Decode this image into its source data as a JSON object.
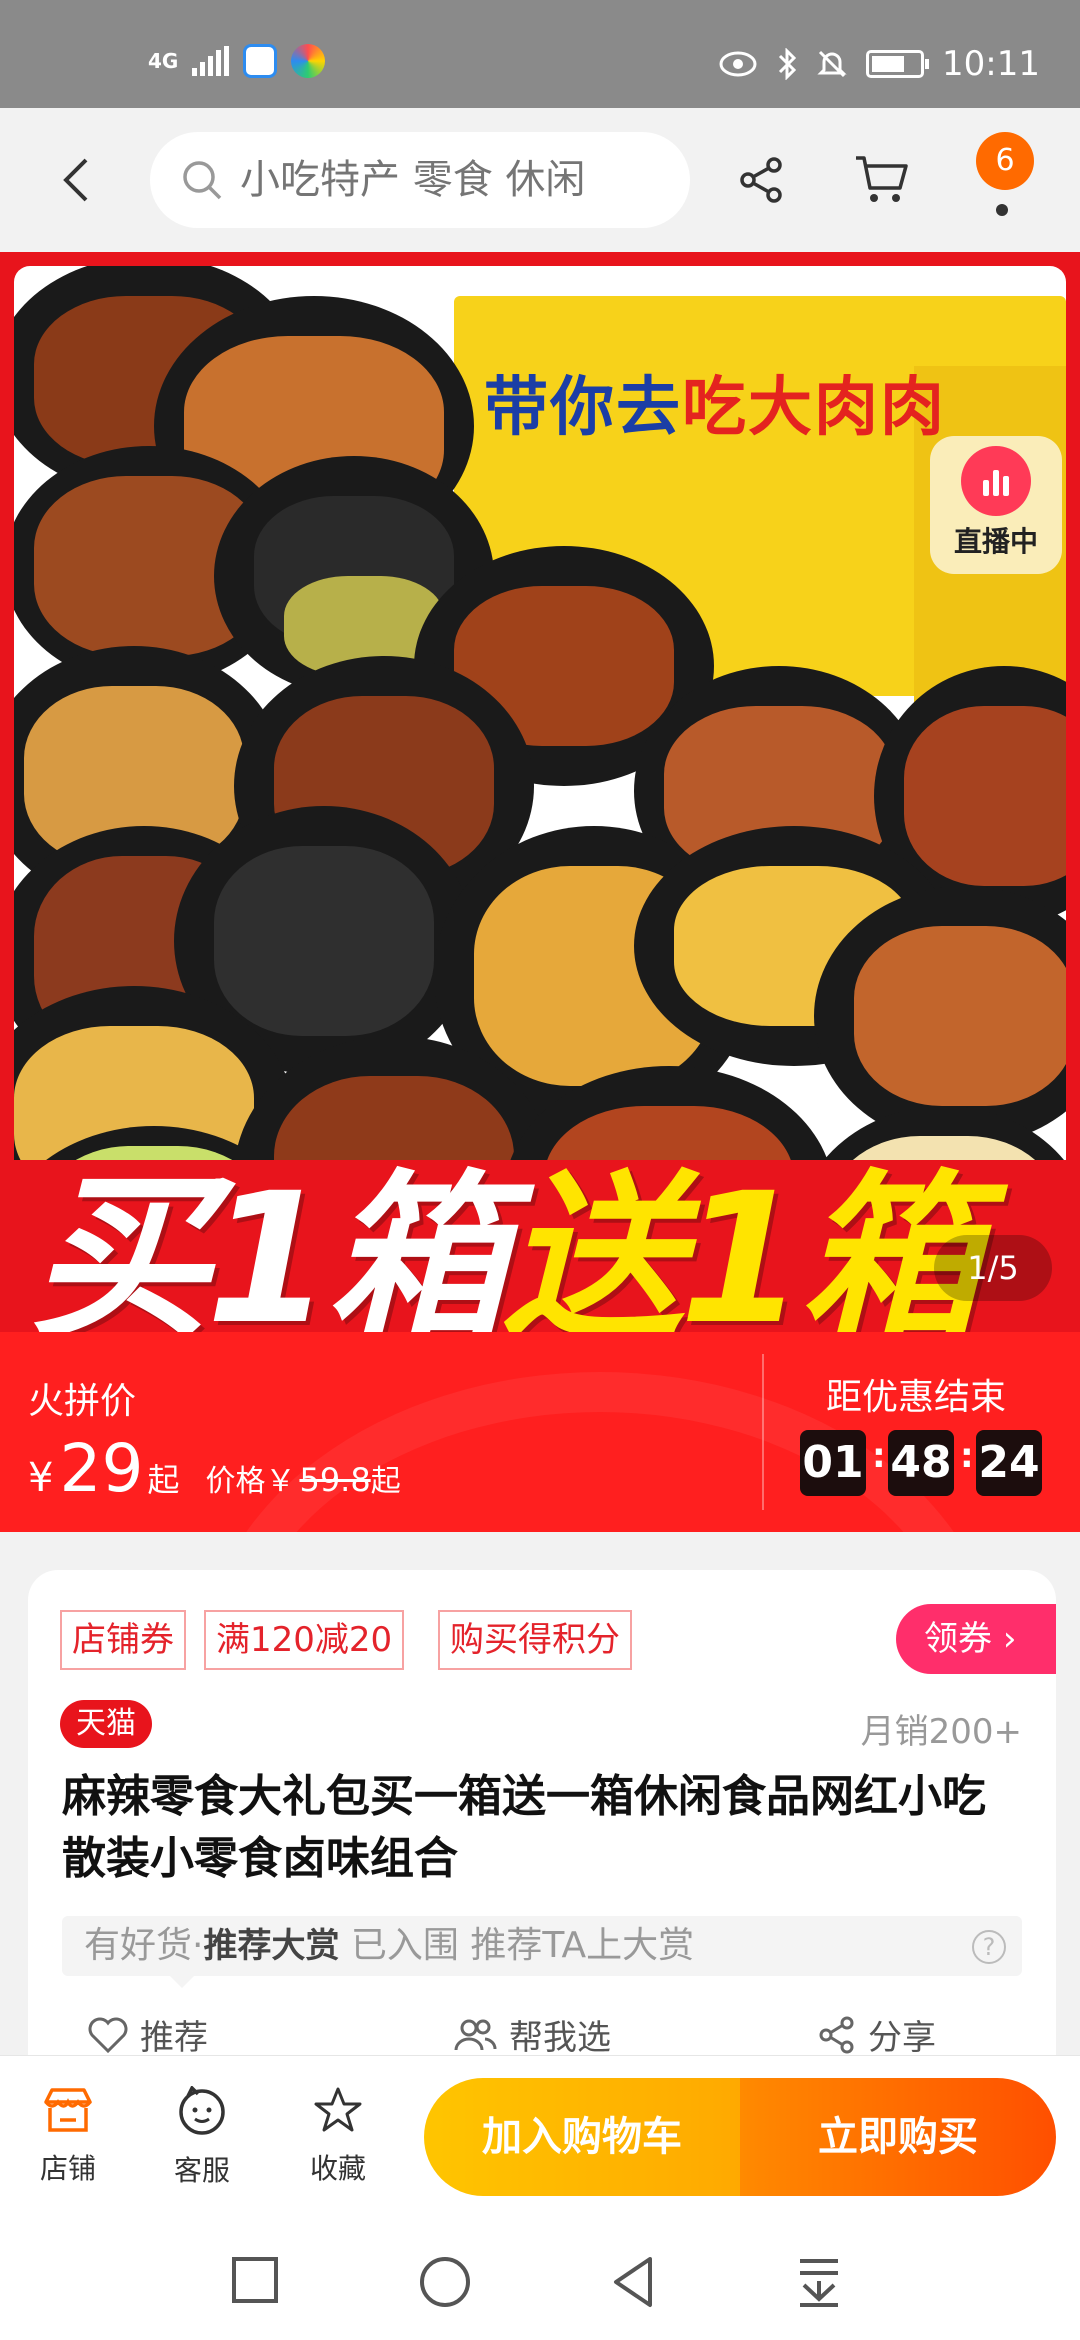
{
  "status_bar": {
    "network": "4G",
    "time": "10:11"
  },
  "header": {
    "search_placeholder": "小吃特产 零食 休闲",
    "message_count": "6"
  },
  "hero": {
    "box_title_blue": "带你去",
    "box_title_red": "吃大肉肉",
    "live_label": "直播中",
    "banner_white_1": "买",
    "banner_num_1": "1",
    "banner_white_2": "箱",
    "banner_yellow_1": "送",
    "banner_yellow_num": "1",
    "banner_yellow_2": "箱",
    "page_indicator": "1/5"
  },
  "price_bar": {
    "label": "火拼价",
    "currency": "¥",
    "price": "29",
    "price_suffix": "起",
    "original_label": "价格￥",
    "original_price": "59.8",
    "original_suffix": "起",
    "countdown_label": "距优惠结束",
    "countdown": {
      "h": "01",
      "m": "48",
      "s": "24"
    }
  },
  "product": {
    "tags": [
      "店铺券",
      "满120减20",
      "购买得积分"
    ],
    "coupon_button": "领券",
    "platform_badge": "天猫",
    "monthly_sales": "月销200+",
    "title": "麻辣零食大礼包买一箱送一箱休闲食品网红小吃散装小零食卤味组合",
    "recommend": {
      "prefix": "有好货·",
      "bold": "推荐大赏",
      "text": " 已入围 推荐TA上大赏",
      "help": "?"
    },
    "actions": [
      "推荐",
      "帮我选",
      "分享"
    ]
  },
  "bottom_bar": {
    "items": [
      "店铺",
      "客服",
      "收藏"
    ],
    "add_to_cart": "加入购物车",
    "buy_now": "立即购买"
  },
  "colors": {
    "brand_red": "#e8141c",
    "price_red": "#ff1f1f",
    "orange": "#ff6a00",
    "yellow_button": "#ffc500",
    "buy_button": "#ff4f00"
  }
}
